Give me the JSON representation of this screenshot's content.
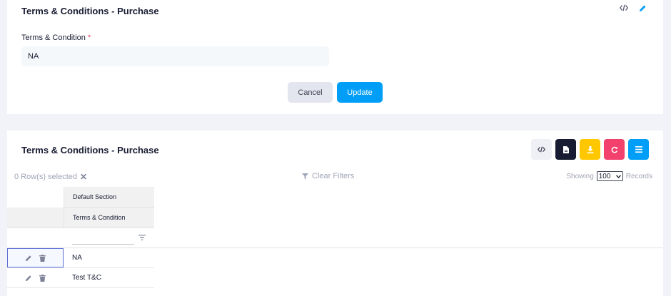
{
  "form": {
    "title": "Terms & Conditions - Purchase",
    "field_label": "Terms & Condition",
    "required_mark": "*",
    "field_value": "NA",
    "cancel_label": "Cancel",
    "update_label": "Update"
  },
  "table_card": {
    "title": "Terms & Conditions - Purchase",
    "selected_text": "0 Row(s) selected",
    "selected_clear": "✕",
    "clear_filters": "Clear Filters",
    "showing_label": "Showing",
    "page_size": "100",
    "records_label": "Records",
    "group_header": "Default Section",
    "column_header": "Terms & Condition",
    "rows": [
      {
        "value": "NA"
      },
      {
        "value": "Test T&C"
      }
    ]
  },
  "colors": {
    "accent": "#009ef7",
    "dark": "#181c32",
    "warning": "#ffc700",
    "danger": "#f1416c"
  },
  "icons": [
    "code-icon",
    "pencil-icon",
    "document-icon",
    "download-icon",
    "refresh-icon",
    "menu-icon",
    "filter-icon",
    "edit-icon",
    "trash-icon"
  ]
}
